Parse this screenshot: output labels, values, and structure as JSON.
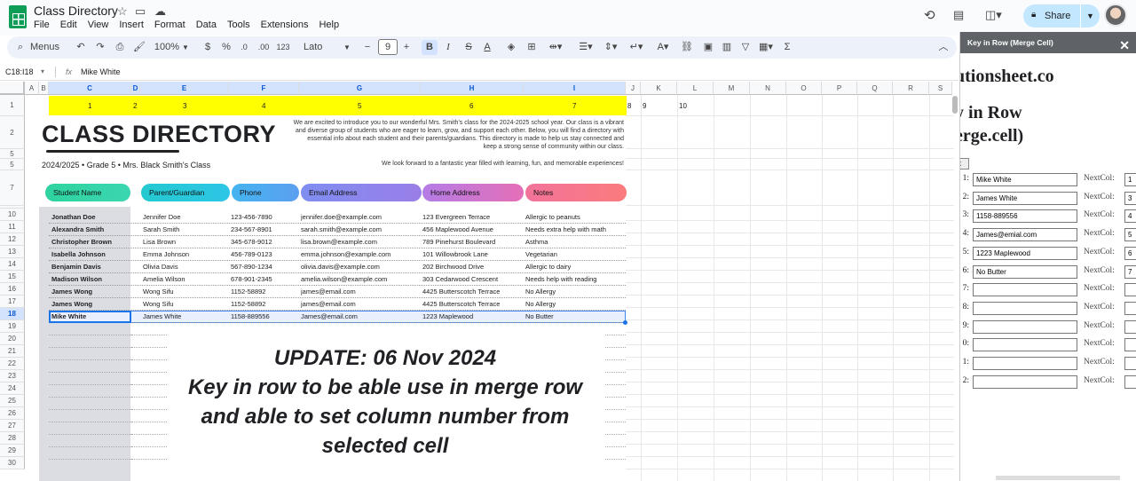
{
  "app": {
    "title": "Class Directory",
    "menu": [
      "File",
      "Edit",
      "View",
      "Insert",
      "Format",
      "Data",
      "Tools",
      "Extensions",
      "Help"
    ],
    "share_label": "Share"
  },
  "toolbar": {
    "menus_label": "Menus",
    "zoom": "100%",
    "currency": "$",
    "percent": "%",
    "decimal_less": ".0",
    "decimal_more": ".00",
    "number_format": "123",
    "font": "Lato",
    "font_size": "9"
  },
  "formula_bar": {
    "cell_ref": "C18:I18",
    "fx": "fx",
    "value": "Mike White"
  },
  "sheet": {
    "columns": [
      "A",
      "B",
      "C",
      "D",
      "E",
      "F",
      "G",
      "H",
      "I",
      "J",
      "K",
      "L",
      "M",
      "N",
      "O",
      "P",
      "Q",
      "R",
      "S"
    ],
    "rows": [
      "1",
      "2",
      "5",
      "5",
      "7",
      "10",
      "11",
      "12",
      "13",
      "14",
      "15",
      "16",
      "17",
      "18",
      "19",
      "20",
      "21",
      "22",
      "23",
      "24",
      "25",
      "26",
      "27",
      "28",
      "29",
      "30"
    ],
    "row1_numbers": [
      "1",
      "2",
      "3",
      "4",
      "5",
      "6",
      "7",
      "8",
      "9",
      "10"
    ]
  },
  "directory": {
    "title": "CLASS DIRECTORY",
    "subtitle": "2024/2025  •  Grade 5  •  Mrs. Black Smith's Class",
    "intro": "We are excited to introduce you to our wonderful Mrs. Smith's class for the 2024-2025 school year. Our class is a vibrant and diverse group of students who are eager to learn, grow, and support each other. Below, you will find a directory with essential info about each student and their parents/guardians. This directory is made to help us stay connected and keep a strong sense of community within our class.",
    "closing": "We look forward to a fantastic year filled with learning, fun, and memorable experiences!",
    "headers": [
      "Student Name",
      "Parent/Guardian",
      "Phone",
      "Email Address",
      "Home Address",
      "Notes"
    ],
    "rows": [
      [
        "Jonathan Doe",
        "Jennifer Doe",
        "123-456-7890",
        "jennifer.doe@example.com",
        "123 Evergreen Terrace",
        "Allergic to peanuts"
      ],
      [
        "Alexandra Smith",
        "Sarah Smith",
        "234-567-8901",
        "sarah.smith@example.com",
        "456 Maplewood Avenue",
        "Needs extra help with math"
      ],
      [
        "Christopher Brown",
        "Lisa Brown",
        "345-678-9012",
        "lisa.brown@example.com",
        "789 Pinehurst Boulevard",
        "Asthma"
      ],
      [
        "Isabella Johnson",
        "Emma Johnson",
        "456-789-0123",
        "emma.johnson@example.com",
        "101 Willowbrook Lane",
        "Vegetarian"
      ],
      [
        "Benjamin Davis",
        "Olivia Davis",
        "567-890-1234",
        "olivia.davis@example.com",
        "202 Birchwood Drive",
        "Allergic to dairy"
      ],
      [
        "Madison Wilson",
        "Amelia Wilson",
        "678-901-2345",
        "amelia.wilson@example.com",
        "303 Cedarwood Crescent",
        "Needs help with reading"
      ],
      [
        "James Wong",
        "Wong Sifu",
        "1152-58892",
        "james@email.com",
        "4425 Butterscotch Terrace",
        "No Allergy"
      ],
      [
        "James Wong",
        "Wong Sifu",
        "1152-58892",
        "james@email.com",
        "4425 Butterscotch Terrace",
        "No Allergy"
      ],
      [
        "Mike White",
        "James White",
        "1158-889556",
        "James@email.com",
        "1223 Maplewood",
        "No Butter"
      ]
    ],
    "update_lines": [
      "UPDATE: 06 Nov 2024",
      "Key in row to be able use in merge row",
      "and able to set column number from",
      "selected cell"
    ]
  },
  "panel": {
    "title": "Key in Row (Merge Cell)",
    "domain_text": "utionsheet.co",
    "heading_line1": "y in Row",
    "heading_line2": "erge.cell)",
    "button_label": "it",
    "nextcol_label": "NextCol:",
    "rows": [
      {
        "label": "1:",
        "value": "Mike White",
        "next": "1"
      },
      {
        "label": "2:",
        "value": "James White",
        "next": "3"
      },
      {
        "label": "3:",
        "value": "1158-889556",
        "next": "4"
      },
      {
        "label": "4:",
        "value": "James@emial.com",
        "next": "5"
      },
      {
        "label": "5:",
        "value": "1223 Maplewood",
        "next": "6"
      },
      {
        "label": "6:",
        "value": "No Butter",
        "next": "7"
      },
      {
        "label": "7:",
        "value": "",
        "next": ""
      },
      {
        "label": "8:",
        "value": "",
        "next": ""
      },
      {
        "label": "9:",
        "value": "",
        "next": ""
      },
      {
        "label": "0:",
        "value": "",
        "next": ""
      },
      {
        "label": "1:",
        "value": "",
        "next": ""
      },
      {
        "label": "2:",
        "value": "",
        "next": ""
      }
    ]
  }
}
